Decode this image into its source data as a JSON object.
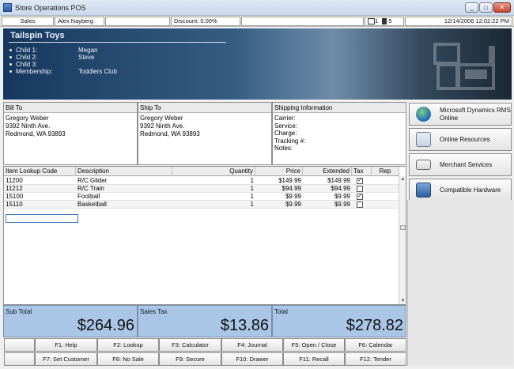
{
  "window": {
    "title": "Store Operations POS"
  },
  "status": {
    "mode": "Sales",
    "cashier": "Alex Nayberg",
    "discount": "Discount: 0.00%",
    "register_count": "1",
    "drawer_count": "5",
    "datetime": "12/14/2006 12:02:22 PM"
  },
  "customer": {
    "store_name": "Tailspin Toys",
    "fields": [
      {
        "label": "Child 1:",
        "value": "Megan"
      },
      {
        "label": "Child 2:",
        "value": "Steve"
      },
      {
        "label": "Child 3:",
        "value": ""
      },
      {
        "label": "Membership:",
        "value": "Toddlers Club"
      }
    ]
  },
  "bill_to": {
    "header": "Bill To",
    "lines": [
      "Gregory Weber",
      "9392 Ninth Ave.",
      "Redmond, WA  93893"
    ]
  },
  "ship_to": {
    "header": "Ship To",
    "lines": [
      "Gregory Weber",
      "9392 Ninth Ave.",
      "Redmond, WA  93893"
    ]
  },
  "shipping": {
    "header": "Shipping Information",
    "lines": [
      "Carrier:",
      "Service:",
      "Charge:",
      "Tracking #:",
      "Notes:"
    ]
  },
  "side_buttons": [
    {
      "label": "Microsoft Dynamics RMS Online",
      "icon": "globe-icon"
    },
    {
      "label": "Online Resources",
      "icon": "document-globe-icon"
    },
    {
      "label": "Merchant Services",
      "icon": "credit-card-icon"
    },
    {
      "label": "Compatible Hardware",
      "icon": "hardware-icon"
    }
  ],
  "grid": {
    "columns": [
      "Item Lookup Code",
      "Description",
      "Quantity",
      "Price",
      "Extended",
      "Tax",
      "Rep"
    ],
    "rows": [
      {
        "code": "11200",
        "description": "R/C Glider",
        "quantity": "1",
        "price": "$149.99",
        "extended": "$149.99",
        "tax": true,
        "rep": ""
      },
      {
        "code": "11212",
        "description": "R/C Train",
        "quantity": "1",
        "price": "$94.99",
        "extended": "$94.99",
        "tax": false,
        "rep": ""
      },
      {
        "code": "15100",
        "description": "Football",
        "quantity": "1",
        "price": "$9.99",
        "extended": "$9.99",
        "tax": true,
        "rep": ""
      },
      {
        "code": "15110",
        "description": "Basketball",
        "quantity": "1",
        "price": "$9.99",
        "extended": "$9.99",
        "tax": false,
        "rep": ""
      }
    ]
  },
  "totals": {
    "subtotal_label": "Sub Total",
    "subtotal": "$264.96",
    "tax_label": "Sales Tax",
    "tax": "$13.86",
    "total_label": "Total",
    "total": "$278.82"
  },
  "function_keys": [
    [
      "",
      "F1: Help",
      "F2: Lookup",
      "F3: Calculator",
      "F4: Journal",
      "F5: Open / Close",
      "F6: Calendar"
    ],
    [
      "",
      "F7: Set Customer",
      "F8: No Sale",
      "F9: Secure",
      "F10: Drawer",
      "F11: Recall",
      "F12: Tender"
    ]
  ],
  "colors": {
    "banner": "#2b5178",
    "totals": "#a9c6e6",
    "selection": "#3c78c8"
  }
}
